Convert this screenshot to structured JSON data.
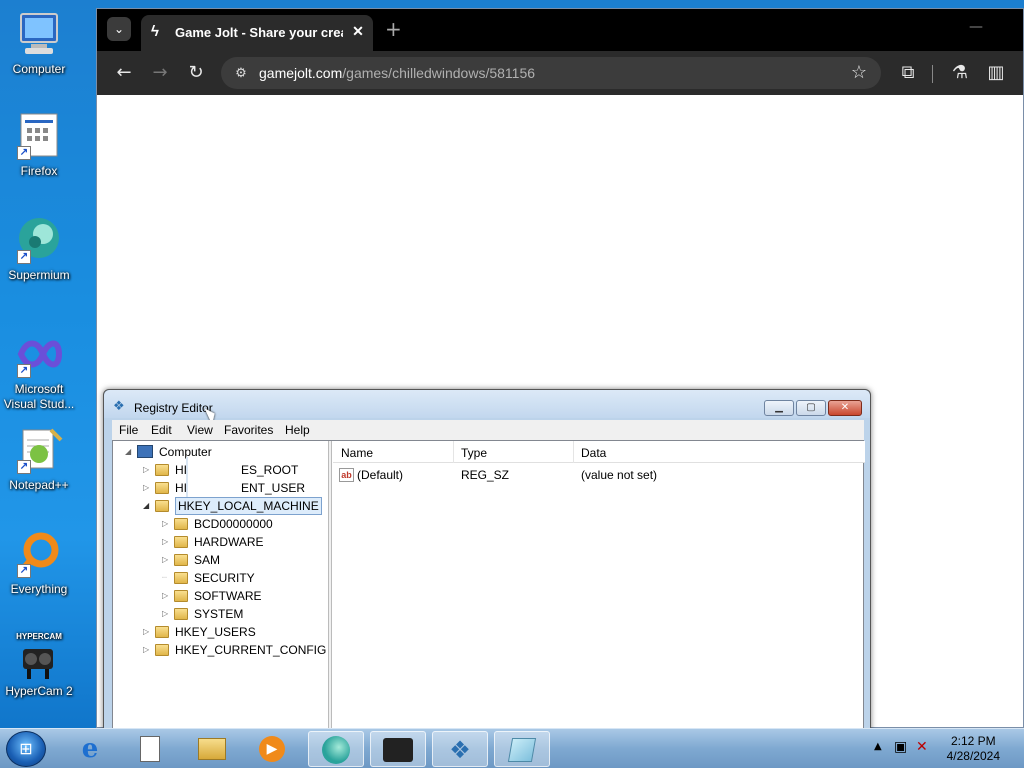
{
  "desktop": {
    "icons": [
      {
        "label": "Computer",
        "icon": "computer-icon"
      },
      {
        "label": "Firefox",
        "icon": "firefox-icon"
      },
      {
        "label": "Supermium",
        "icon": "supermium-icon"
      },
      {
        "label_line1": "Microsoft",
        "label_line2": "Visual Stud...",
        "icon": "visual-studio-icon"
      },
      {
        "label": "Notepad++",
        "icon": "notepadpp-icon"
      },
      {
        "label": "Everything",
        "icon": "everything-icon"
      },
      {
        "label": "HyperCam 2",
        "icon": "hypercam-icon",
        "badge": "HYPERCAM"
      }
    ]
  },
  "browser": {
    "tab": {
      "title": "Game Jolt - Share your creations",
      "close": "✕"
    },
    "new_tab": "+",
    "omnibox": {
      "host": "gamejolt.com",
      "path": "/games/chilledwindows/581156"
    },
    "dark_theme_bg": "#2b2b2b"
  },
  "regedit": {
    "title": "Registry Editor",
    "menu": [
      "File",
      "Edit",
      "View",
      "Favorites",
      "Help"
    ],
    "tree": {
      "root": "Computer",
      "hkcr": "HKEY_CLASSES_ROOT",
      "hkcr_visible": "HI",
      "hkcr_tail": "ES_ROOT",
      "hkcu_visible": "HI",
      "hkcu_tail": "ENT_USER",
      "hklm": "HKEY_LOCAL_MACHINE",
      "hklm_children": [
        "BCD00000000",
        "HARDWARE",
        "SAM",
        "SECURITY",
        "SOFTWARE",
        "SYSTEM"
      ],
      "hku": "HKEY_USERS",
      "hkcc": "HKEY_CURRENT_CONFIG"
    },
    "columns": {
      "name": "Name",
      "type": "Type",
      "data": "Data"
    },
    "values": [
      {
        "name": "(Default)",
        "type": "REG_SZ",
        "data": "(value not set)",
        "icon": "ab"
      }
    ]
  },
  "taskbar": {
    "items": [
      "ie-icon",
      "document-icon",
      "explorer-icon",
      "media-player-icon",
      "supermium-icon",
      "hypercam-icon",
      "regedit-icon",
      "notepad-icon"
    ],
    "clock_time": "2:12 PM",
    "clock_date": "4/28/2024"
  }
}
